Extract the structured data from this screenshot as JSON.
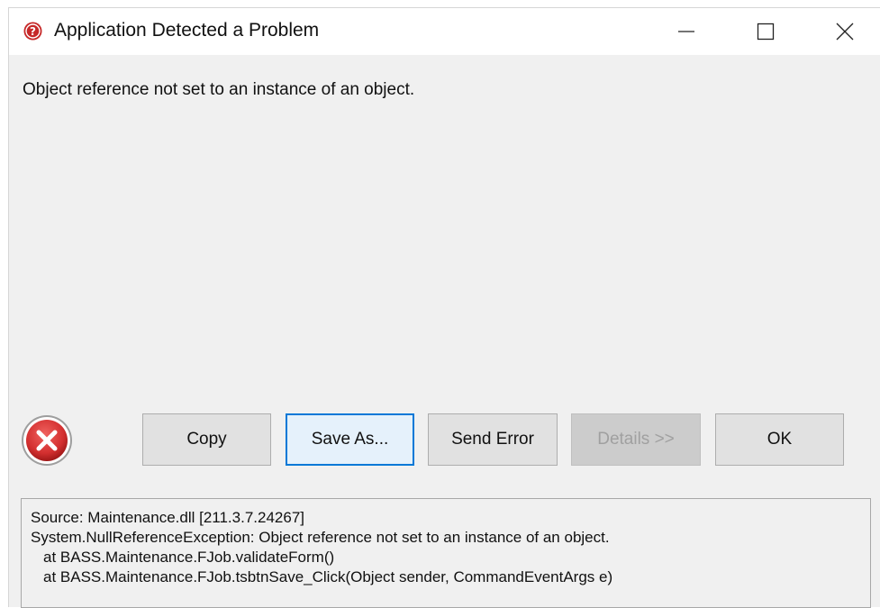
{
  "window": {
    "title": "Application Detected a Problem",
    "app_icon": "question-circle-icon",
    "controls": {
      "minimize": "minimize-icon",
      "maximize": "maximize-icon",
      "close": "close-icon"
    }
  },
  "message": "Object reference not set to an instance of an object.",
  "error_icon": "error-x-circle-icon",
  "buttons": {
    "copy": "Copy",
    "save_as": "Save As...",
    "send_error": "Send Error",
    "details": "Details >>",
    "ok": "OK"
  },
  "details": {
    "lines": [
      "Source: Maintenance.dll [211.3.7.24267]",
      "System.NullReferenceException: Object reference not set to an instance of an object.",
      "at BASS.Maintenance.FJob.validateForm()",
      "at BASS.Maintenance.FJob.tsbtnSave_Click(Object sender, CommandEventArgs e)"
    ]
  },
  "colors": {
    "window_bg": "#f0f0f0",
    "titlebar_bg": "#ffffff",
    "focus_border": "#0078d7",
    "error_red": "#d32f2f"
  }
}
